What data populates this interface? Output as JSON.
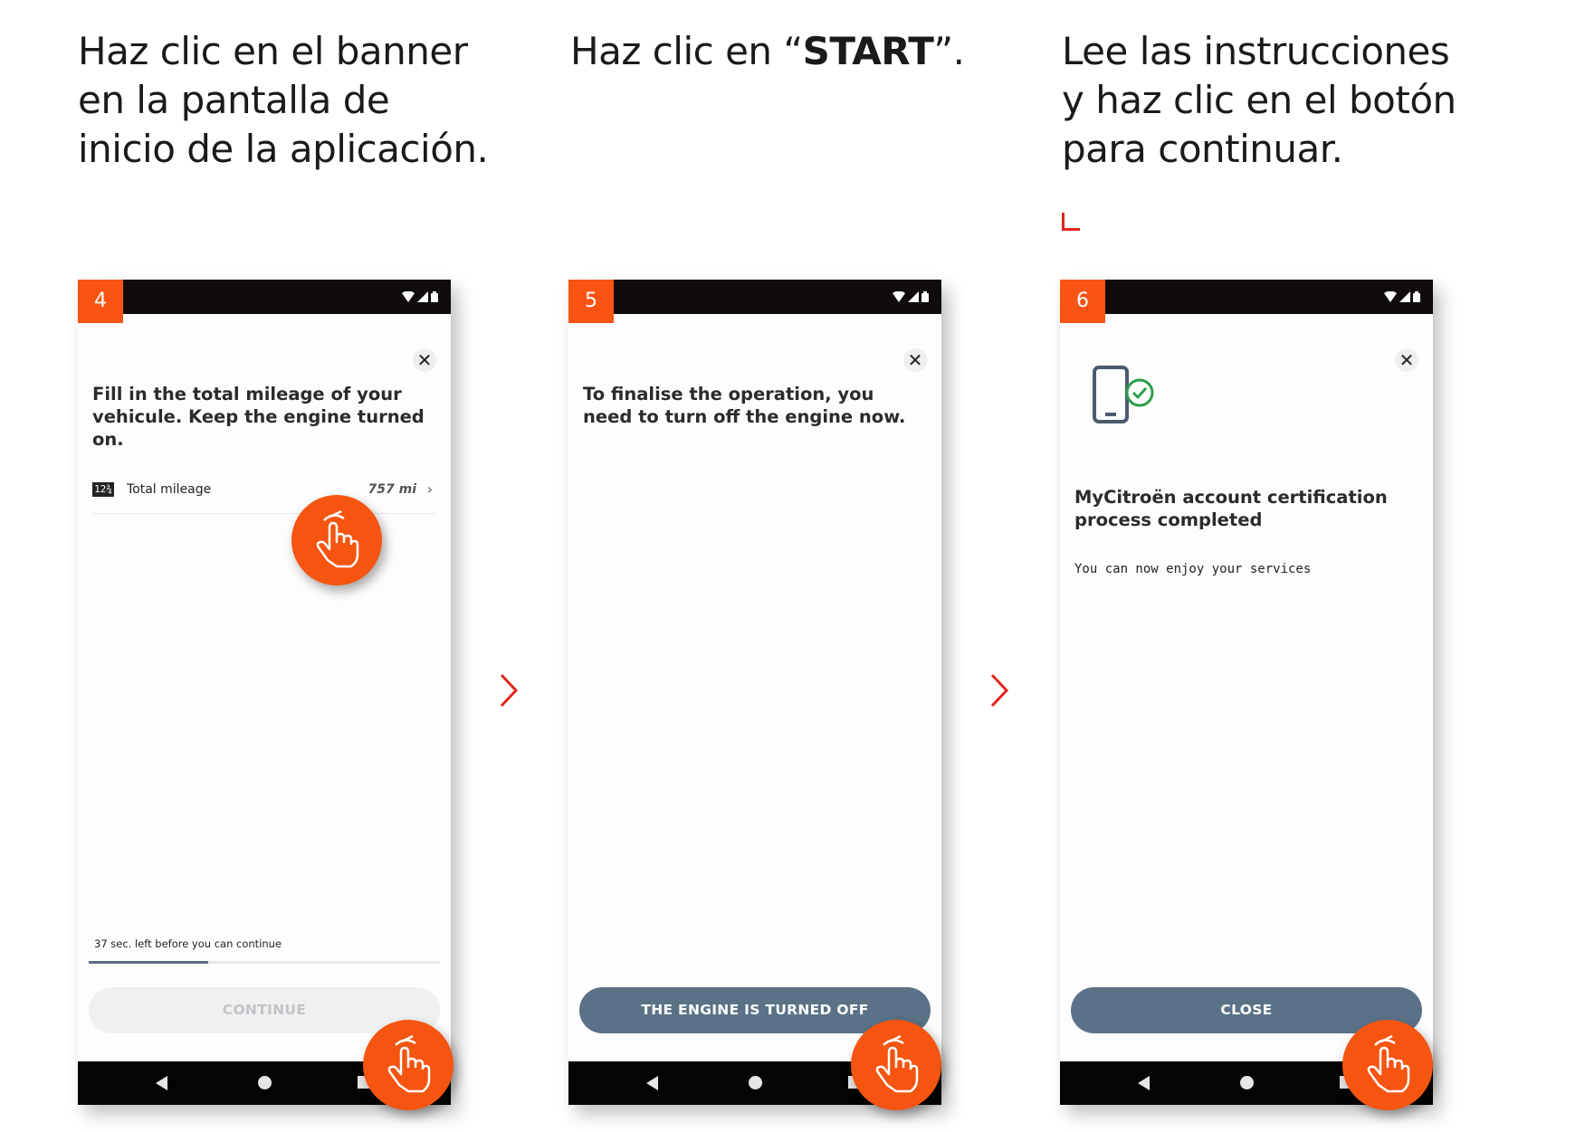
{
  "captions": [
    {
      "text": "Haz clic en el banner en la pantalla de inicio de la aplicación."
    },
    {
      "before": "Haz clic en “",
      "bold": "START",
      "after": "”."
    },
    {
      "text": "Lee las instrucciones y haz clic en el botón para continuar."
    }
  ],
  "screens": [
    {
      "step": "4",
      "close_label": "✕",
      "heading": "Fill in the total mileage of your vehicule. Keep the engine turned on.",
      "mileage_icon_text": "12¾",
      "mileage_label": "Total mileage",
      "mileage_value": "757 mi",
      "mileage_chevron": "›",
      "timer_text": "37 sec. left before you can continue",
      "progress_fraction": 0.34,
      "button_label": "CONTINUE",
      "button_state": "disabled"
    },
    {
      "step": "5",
      "close_label": "✕",
      "heading": "To finalise the operation, you need to turn off the engine now.",
      "button_label": "THE ENGINE IS TURNED OFF",
      "button_state": "active"
    },
    {
      "step": "6",
      "close_label": "✕",
      "icon": "phone-check-icon",
      "title": "MyCitroën account certification process completed",
      "subtitle": "You can now enjoy your services",
      "button_label": "CLOSE",
      "button_state": "active"
    }
  ],
  "colors": {
    "badge": "#fa5414",
    "tap_circle": "#f55510",
    "button_active": "#5b7187",
    "arrow": "#e0261b",
    "status_bar": "#100c0c",
    "check_green": "#2e9d4a"
  }
}
